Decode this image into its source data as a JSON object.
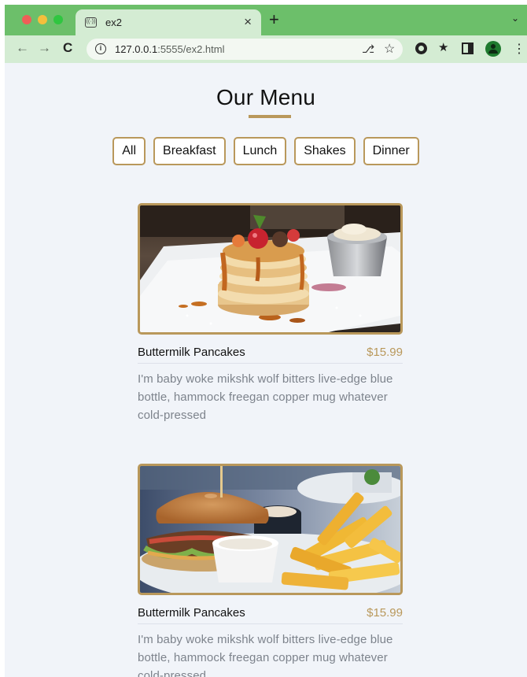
{
  "browser": {
    "tab_title": "ex2",
    "tab_favicon": "((·))",
    "url_host": "127.0.0.1",
    "url_rest": ":5555/ex2.html"
  },
  "page": {
    "title": "Our Menu",
    "filters": [
      "All",
      "Breakfast",
      "Lunch",
      "Shakes",
      "Dinner"
    ]
  },
  "menu_items": [
    {
      "name": "Buttermilk Pancakes",
      "price": "$15.99",
      "description": "I'm baby woke mikshk wolf bitters live-edge blue bottle, hammock freegan copper mug whatever cold-pressed",
      "image": "pancakes-photo"
    },
    {
      "name": "Buttermilk Pancakes",
      "price": "$15.99",
      "description": "I'm baby woke mikshk wolf bitters live-edge blue bottle, hammock freegan copper mug whatever cold-pressed",
      "image": "burger-fries-photo"
    }
  ],
  "colors": {
    "accent": "#b9985b",
    "page_bg": "#f1f4f9",
    "chrome_tabbar": "#6cbf6a",
    "chrome_toolbar": "#d4ecd3"
  }
}
